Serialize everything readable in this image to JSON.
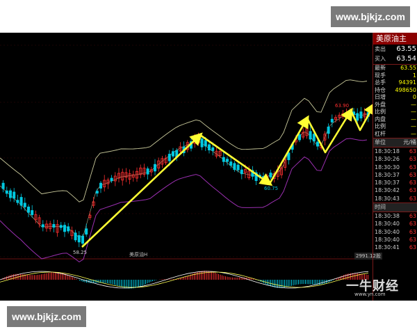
{
  "watermark": {
    "top_text": "www.bjkjz.com",
    "bottom_text": "www.bjkjz.com"
  },
  "logo": {
    "text": "一牛财经",
    "url": "www.yn.com"
  },
  "chart": {
    "low_label": "58.25",
    "mid_label": "60.75",
    "high_label": "63.90",
    "subchart_label": "美原油H",
    "pane_badge": "2991.12股",
    "colors": {
      "up": "#ff3030",
      "down": "#00c8e0",
      "arrow": "#ffff33",
      "band": "#c8c89a",
      "ma": "#9a2fb0"
    }
  },
  "side_panel": {
    "symbol": "美原油主",
    "quotes": [
      {
        "label": "卖出",
        "value": "63.55"
      },
      {
        "label": "买入",
        "value": "63.54"
      }
    ],
    "stats": [
      {
        "label": "最新",
        "value": "63.55"
      },
      {
        "label": "现手",
        "value": "1"
      },
      {
        "label": "总手",
        "value": "94391"
      },
      {
        "label": "持仓",
        "value": "498650"
      },
      {
        "label": "日增",
        "value": "0"
      },
      {
        "label": "外盘",
        "value": "—"
      },
      {
        "label": "比例",
        "value": "—"
      },
      {
        "label": "内盘",
        "value": "—"
      },
      {
        "label": "比例",
        "value": "—"
      },
      {
        "label": "杠杆",
        "value": "—"
      }
    ],
    "trade_header": {
      "col1": "单位",
      "col2": "元/桶"
    },
    "trades1": [
      {
        "time": "18:30:18",
        "price": "63"
      },
      {
        "time": "18:30:26",
        "price": "63"
      },
      {
        "time": "18:30:30",
        "price": "63"
      },
      {
        "time": "18:30:37",
        "price": "63"
      },
      {
        "time": "18:30:37",
        "price": "63"
      },
      {
        "time": "18:30:42",
        "price": "63"
      },
      {
        "time": "18:30:43",
        "price": "63"
      }
    ],
    "trade_header2": {
      "col1": "时间",
      "col2": ""
    },
    "trades2": [
      {
        "time": "18:30:38",
        "price": "63"
      },
      {
        "time": "18:30:40",
        "price": "63"
      },
      {
        "time": "18:30:40",
        "price": "63"
      },
      {
        "time": "18:30:40",
        "price": "63"
      },
      {
        "time": "18:30:41",
        "price": "63"
      }
    ]
  }
}
